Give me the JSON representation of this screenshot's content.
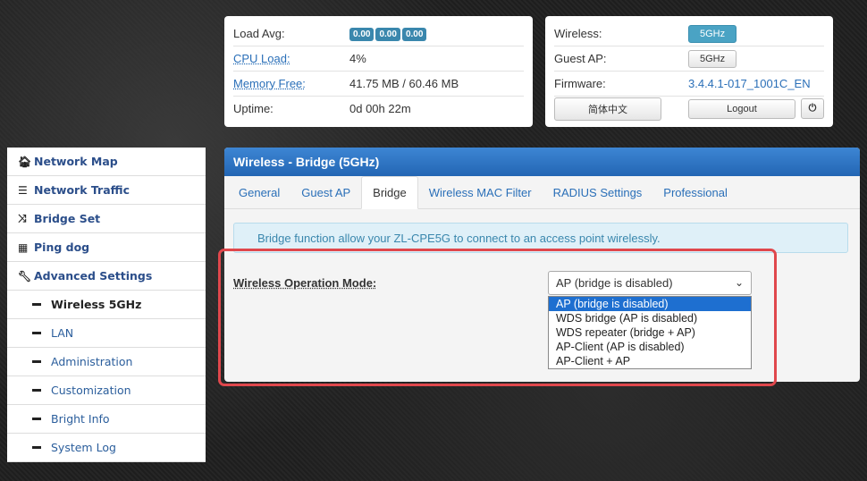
{
  "status": {
    "load_avg_label": "Load Avg:",
    "load_avg_values": [
      "0.00",
      "0.00",
      "0.00"
    ],
    "cpu_label": "CPU Load:",
    "cpu_value": "4%",
    "memory_label": "Memory Free:",
    "memory_value": "41.75 MB / 60.46 MB",
    "uptime_label": "Uptime:",
    "uptime_value": "0d 00h 22m"
  },
  "info": {
    "wireless_label": "Wireless:",
    "wireless_button": "5GHz",
    "guest_label": "Guest AP:",
    "guest_button": "5GHz",
    "firmware_label": "Firmware:",
    "firmware_value": "3.4.4.1-017_1001C_EN",
    "language_button": "简体中文",
    "logout_button": "Logout",
    "power_icon": "⏻"
  },
  "sidebar": {
    "items": [
      {
        "label": "Network Map",
        "icon": "home-icon",
        "glyph": "🏠︎"
      },
      {
        "label": "Network Traffic",
        "icon": "list-icon",
        "glyph": "☰"
      },
      {
        "label": "Bridge Set",
        "icon": "shuffle-icon",
        "glyph": "⤨"
      },
      {
        "label": "Ping dog",
        "icon": "grid-icon",
        "glyph": "▦"
      },
      {
        "label": "Advanced Settings",
        "icon": "wrench-icon",
        "glyph": "🔧︎"
      }
    ],
    "sub_items": [
      {
        "label": "Wireless 5GHz"
      },
      {
        "label": "LAN"
      },
      {
        "label": "Administration"
      },
      {
        "label": "Customization"
      },
      {
        "label": "Bright Info"
      },
      {
        "label": "System Log"
      }
    ]
  },
  "panel": {
    "title": "Wireless - Bridge (5GHz)",
    "tabs": [
      "General",
      "Guest AP",
      "Bridge",
      "Wireless MAC Filter",
      "RADIUS Settings",
      "Professional"
    ],
    "active_tab": "Bridge",
    "notice": "Bridge function allow your ZL-CPE5G to connect to an access point wirelessly.",
    "mode_label": "Wireless Operation Mode:",
    "mode_selected": "AP (bridge is disabled)",
    "mode_options": [
      "AP (bridge is disabled)",
      "WDS bridge (AP is disabled)",
      "WDS repeater (bridge + AP)",
      "AP-Client (AP is disabled)",
      "AP-Client + AP"
    ]
  },
  "colors": {
    "header_blue": "#2366b4",
    "accent": "#4aa3c4",
    "highlight_red": "#e0474c"
  }
}
